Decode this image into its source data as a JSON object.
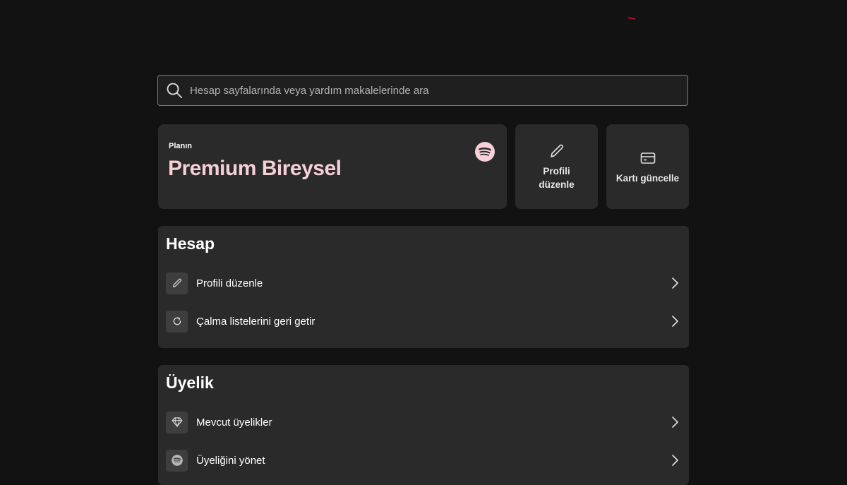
{
  "search": {
    "placeholder": "Hesap sayfalarında veya yardım makalelerinde ara",
    "icon": "search-icon"
  },
  "plan": {
    "label": "Planın",
    "name": "Premium Bireysel",
    "logo": "spotify-icon",
    "accent_color": "#f5d0d8"
  },
  "quick_actions": [
    {
      "label": "Profili düzenle",
      "icon": "pencil-icon"
    },
    {
      "label": "Kartı güncelle",
      "icon": "card-icon"
    }
  ],
  "sections": [
    {
      "title": "Hesap",
      "items": [
        {
          "label": "Profili düzenle",
          "icon": "pencil-icon"
        },
        {
          "label": "Çalma listelerini geri getir",
          "icon": "refresh-icon"
        }
      ]
    },
    {
      "title": "Üyelik",
      "items": [
        {
          "label": "Mevcut üyelikler",
          "icon": "diamond-icon"
        },
        {
          "label": "Üyeliğini yönet",
          "icon": "spotify-icon"
        }
      ]
    }
  ]
}
